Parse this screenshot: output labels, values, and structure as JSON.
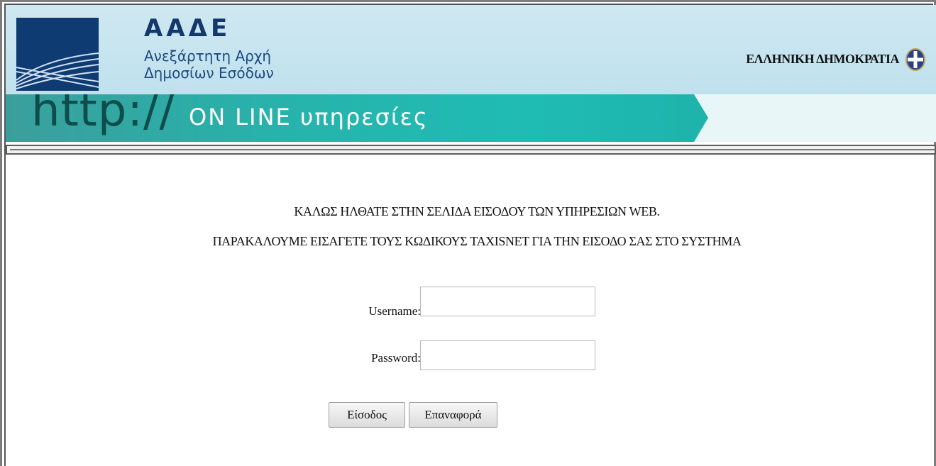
{
  "header": {
    "brand_title": "ΑΑΔΕ",
    "brand_sub_line1": "Ανεξάρτητη Αρχή",
    "brand_sub_line2": "Δημοσίων Εσόδων",
    "republic_label": "ΕΛΛΗΝΙΚΗ ΔΗΜΟΚΡΑΤΙΑ"
  },
  "banner": {
    "http_text": "http://",
    "online_text": "ON LINE υπηρεσίες"
  },
  "main": {
    "welcome_line1": "ΚΑΛΩΣ ΗΛΘΑΤΕ ΣΤΗΝ ΣΕΛΙΔΑ ΕΙΣΟΔΟΥ ΤΩΝ ΥΠΗΡΕΣΙΩΝ WEB.",
    "welcome_line2": "ΠΑΡΑΚΑΛΟΥΜΕ ΕΙΣΑΓΕΤΕ ΤΟΥΣ ΚΩΔΙΚΟΥΣ TAXISNET ΓΙΑ ΤΗΝ ΕΙΣΟΔΟ ΣΑΣ ΣΤΟ ΣΥΣΤΗΜΑ"
  },
  "form": {
    "username_label": "Username:",
    "username_value": "",
    "password_label": "Password:",
    "password_value": "",
    "login_button": "Είσοδος",
    "reset_button": "Επαναφορά"
  },
  "colors": {
    "header_bg": "#c5e4ef",
    "logo_navy": "#0f3b73",
    "banner_teal": "#27b3ac",
    "brand_text": "#14386c"
  },
  "icons": {
    "logo": "aade-logo-icon",
    "emblem": "greek-emblem-icon"
  }
}
